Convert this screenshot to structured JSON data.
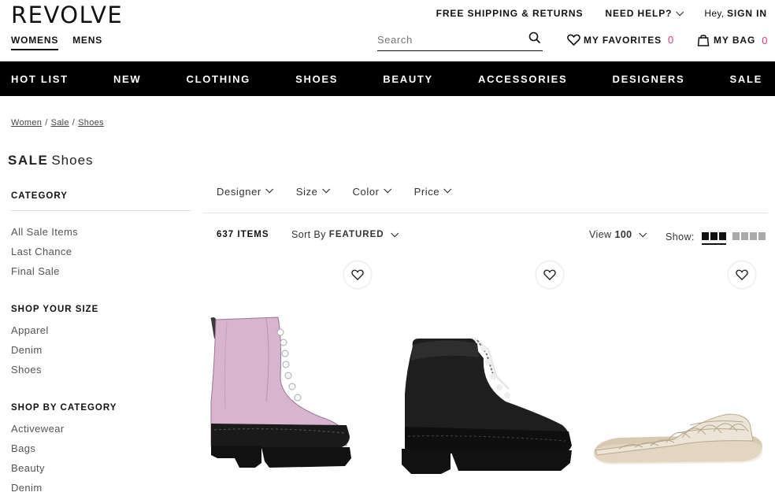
{
  "logo": "REVOLVE",
  "gender_tabs": [
    {
      "label": "WOMENS",
      "active": true
    },
    {
      "label": "MENS",
      "active": false
    }
  ],
  "util": {
    "shipping": "FREE SHIPPING & RETURNS",
    "help": "NEED HELP?",
    "hey": "Hey,",
    "sign_in": "SIGN IN"
  },
  "search": {
    "placeholder": "Search",
    "value": ""
  },
  "favorites": {
    "label": "MY FAVORITES",
    "count": "0"
  },
  "bag": {
    "label": "MY BAG",
    "count": "0"
  },
  "nav": [
    "HOT LIST",
    "NEW",
    "CLOTHING",
    "SHOES",
    "BEAUTY",
    "ACCESSORIES",
    "DESIGNERS",
    "SALE"
  ],
  "breadcrumb": [
    "Women",
    "Sale",
    "Shoes"
  ],
  "page_title": {
    "bold": "SALE",
    "rest": "Shoes"
  },
  "sidebar": {
    "category": {
      "heading": "CATEGORY",
      "items": [
        "All Sale Items",
        "Last Chance",
        "Final Sale"
      ]
    },
    "size": {
      "heading": "SHOP YOUR SIZE",
      "items": [
        "Apparel",
        "Denim",
        "Shoes"
      ]
    },
    "by_category": {
      "heading": "SHOP BY CATEGORY",
      "items": [
        "Activewear",
        "Bags",
        "Beauty",
        "Denim"
      ]
    }
  },
  "filters": [
    "Designer",
    "Size",
    "Color",
    "Price"
  ],
  "toolbar": {
    "items_count": "637 ITEMS",
    "sort_label": "Sort By",
    "sort_value": "FEATURED",
    "view_label": "View",
    "view_value": "100",
    "show_label": "Show:"
  },
  "colors": {
    "accent_pink": "#e0367d",
    "nav_bg": "#000000"
  },
  "products": [
    {
      "image": "pink-pearl-boot"
    },
    {
      "image": "black-hiker-boot"
    },
    {
      "image": "woven-slide-sandal"
    }
  ]
}
